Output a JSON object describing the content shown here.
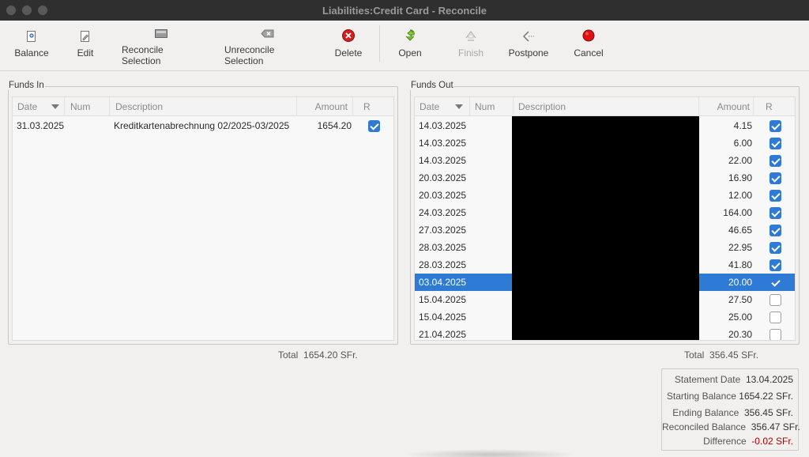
{
  "window": {
    "title": "Liabilities:Credit Card - Reconcile"
  },
  "toolbar": {
    "balance": "Balance",
    "edit": "Edit",
    "reconcile_selection": "Reconcile Selection",
    "unreconcile_selection": "Unreconcile Selection",
    "delete": "Delete",
    "open": "Open",
    "finish": "Finish",
    "postpone": "Postpone",
    "cancel": "Cancel"
  },
  "columns": {
    "date": "Date",
    "num": "Num",
    "description": "Description",
    "amount": "Amount",
    "r": "R"
  },
  "funds_in": {
    "label": "Funds In",
    "rows": [
      {
        "date": "31.03.2025",
        "num": "",
        "description": "Kreditkartenabrechnung 02/2025-03/2025",
        "amount": "1654.20",
        "reconciled": true
      }
    ],
    "total_label": "Total",
    "total": "1654.20 SFr."
  },
  "funds_out": {
    "label": "Funds Out",
    "rows": [
      {
        "date": "14.03.2025",
        "amount": "4.15",
        "reconciled": true,
        "selected": false
      },
      {
        "date": "14.03.2025",
        "amount": "6.00",
        "reconciled": true,
        "selected": false
      },
      {
        "date": "14.03.2025",
        "amount": "22.00",
        "reconciled": true,
        "selected": false
      },
      {
        "date": "20.03.2025",
        "amount": "16.90",
        "reconciled": true,
        "selected": false
      },
      {
        "date": "20.03.2025",
        "amount": "12.00",
        "reconciled": true,
        "selected": false
      },
      {
        "date": "24.03.2025",
        "amount": "164.00",
        "reconciled": true,
        "selected": false
      },
      {
        "date": "27.03.2025",
        "amount": "46.65",
        "reconciled": true,
        "selected": false
      },
      {
        "date": "28.03.2025",
        "amount": "22.95",
        "reconciled": true,
        "selected": false
      },
      {
        "date": "28.03.2025",
        "amount": "41.80",
        "reconciled": true,
        "selected": false
      },
      {
        "date": "03.04.2025",
        "amount": "20.00",
        "reconciled": true,
        "selected": true
      },
      {
        "date": "15.04.2025",
        "amount": "27.50",
        "reconciled": false,
        "selected": false
      },
      {
        "date": "15.04.2025",
        "amount": "25.00",
        "reconciled": false,
        "selected": false
      },
      {
        "date": "21.04.2025",
        "amount": "20.30",
        "reconciled": false,
        "selected": false
      }
    ],
    "total_label": "Total",
    "total": "356.45 SFr."
  },
  "summary": {
    "statement_date_label": "Statement Date",
    "statement_date": "13.04.2025",
    "starting_balance_label": "Starting Balance",
    "starting_balance": "1654.22 SFr.",
    "ending_balance_label": "Ending Balance",
    "ending_balance": "356.45 SFr.",
    "reconciled_balance_label": "Reconciled Balance",
    "reconciled_balance": "356.47 SFr.",
    "difference_label": "Difference",
    "difference": "-0.02 SFr."
  },
  "colors": {
    "selection": "#2e7bd6",
    "checkbox": "#2f7ad4",
    "difference_negative": "#b00000",
    "titlebar": "#2f2f2f"
  },
  "icons": {
    "balance": "balance-icon",
    "edit": "edit-icon",
    "reconcile_selection": "reconcile-icon",
    "unreconcile_selection": "unreconcile-icon",
    "delete": "delete-icon",
    "open": "open-icon",
    "finish": "finish-icon",
    "postpone": "postpone-icon",
    "cancel": "cancel-icon",
    "sort": "sort-down-icon"
  }
}
